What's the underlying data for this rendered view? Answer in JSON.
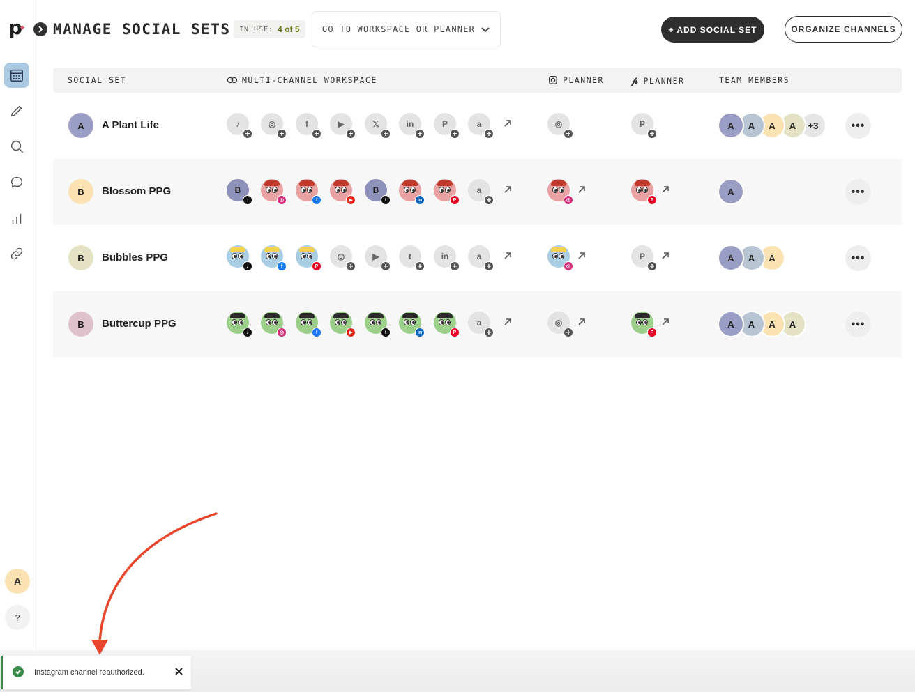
{
  "sidebar": {
    "logo_text": "p",
    "nav": [
      {
        "name": "calendar-icon",
        "active": true
      },
      {
        "name": "pencil-icon"
      },
      {
        "name": "search-icon"
      },
      {
        "name": "chat-icon"
      },
      {
        "name": "analytics-icon"
      },
      {
        "name": "link-icon"
      }
    ],
    "user_initial": "A",
    "help_label": "?"
  },
  "header": {
    "title": "MANAGE SOCIAL SETS",
    "in_use_label": "IN USE:",
    "in_use_value": "4 of 5",
    "goto_label": "GO TO WORKSPACE OR PLANNER",
    "add_button": "+ ADD SOCIAL SET",
    "organize_button": "ORGANIZE CHANNELS"
  },
  "table": {
    "columns": {
      "social_set": "SOCIAL SET",
      "workspace": "MULTI-CHANNEL WORKSPACE",
      "ig_planner": "PLANNER",
      "pin_planner": "PLANNER",
      "team": "TEAM MEMBERS"
    },
    "rows": [
      {
        "initial": "A",
        "name": "A Plant Life",
        "avatar_color": "#9a9dc4",
        "channels": [
          {
            "icon": "♪",
            "type": "empty"
          },
          {
            "icon": "◎",
            "type": "empty"
          },
          {
            "icon": "f",
            "type": "empty"
          },
          {
            "icon": "▶",
            "type": "empty"
          },
          {
            "icon": "𝕏",
            "type": "empty"
          },
          {
            "icon": "in",
            "type": "empty"
          },
          {
            "icon": "P",
            "type": "empty"
          },
          {
            "icon": "a",
            "type": "empty"
          }
        ],
        "ig_planner": {
          "icon": "◎",
          "type": "empty",
          "arrow": false
        },
        "pin_planner": {
          "icon": "P",
          "type": "empty",
          "arrow": false
        },
        "team": [
          "A",
          "A",
          "A",
          "A",
          "+3"
        ]
      },
      {
        "initial": "B",
        "name": "Blossom PPG",
        "avatar_color": "#fbe2b3",
        "channels": [
          {
            "icon": "B",
            "type": "letter",
            "badge": "tiktok"
          },
          {
            "icon": "",
            "type": "photo",
            "badge": "instagram"
          },
          {
            "icon": "",
            "type": "photo",
            "badge": "facebook"
          },
          {
            "icon": "",
            "type": "photo",
            "badge": "youtube"
          },
          {
            "icon": "B",
            "type": "letter",
            "badge": "twitter"
          },
          {
            "icon": "",
            "type": "photo",
            "badge": "linkedin"
          },
          {
            "icon": "",
            "type": "photo",
            "badge": "pinterest"
          },
          {
            "icon": "a",
            "type": "empty"
          }
        ],
        "ig_planner": {
          "icon": "",
          "type": "photo",
          "badge": "instagram",
          "arrow": true
        },
        "pin_planner": {
          "icon": "",
          "type": "photo",
          "badge": "pinterest",
          "arrow": true
        },
        "team": [
          "A"
        ]
      },
      {
        "initial": "B",
        "name": "Bubbles PPG",
        "avatar_color": "#e4e2c4",
        "channels": [
          {
            "icon": "",
            "type": "photo",
            "badge": "tiktok"
          },
          {
            "icon": "",
            "type": "photo",
            "badge": "facebook"
          },
          {
            "icon": "",
            "type": "photo",
            "badge": "pinterest"
          },
          {
            "icon": "◎",
            "type": "empty"
          },
          {
            "icon": "▶",
            "type": "empty"
          },
          {
            "icon": "t",
            "type": "empty"
          },
          {
            "icon": "in",
            "type": "empty"
          },
          {
            "icon": "a",
            "type": "empty"
          }
        ],
        "ig_planner": {
          "icon": "",
          "type": "photo",
          "badge": "instagram",
          "arrow": true
        },
        "pin_planner": {
          "icon": "P",
          "type": "empty",
          "arrow": true
        },
        "team": [
          "A",
          "A",
          "A"
        ]
      },
      {
        "initial": "B",
        "name": "Buttercup PPG",
        "avatar_color": "#e0c2cc",
        "channels": [
          {
            "icon": "",
            "type": "photo",
            "badge": "tiktok"
          },
          {
            "icon": "",
            "type": "photo",
            "badge": "instagram"
          },
          {
            "icon": "",
            "type": "photo",
            "badge": "facebook"
          },
          {
            "icon": "",
            "type": "photo",
            "badge": "youtube"
          },
          {
            "icon": "",
            "type": "photo",
            "badge": "twitter"
          },
          {
            "icon": "",
            "type": "photo",
            "badge": "linkedin"
          },
          {
            "icon": "",
            "type": "photo",
            "badge": "pinterest"
          },
          {
            "icon": "a",
            "type": "empty"
          }
        ],
        "ig_planner": {
          "icon": "◎",
          "type": "empty",
          "arrow": true
        },
        "pin_planner": {
          "icon": "",
          "type": "photo",
          "badge": "pinterest",
          "arrow": true
        },
        "team": [
          "A",
          "A",
          "A",
          "A"
        ]
      }
    ],
    "more_label": "•••"
  },
  "toast": {
    "message": "Instagram channel reauthorized."
  },
  "colors": {
    "accent_dark": "#2e2e2e",
    "success": "#3a8a4a",
    "annotation_arrow": "#e8472e",
    "team": [
      "#9a9dc4",
      "#b7c4d4",
      "#fbe2b3",
      "#e4e2c4"
    ],
    "badges": {
      "tiktok": "#111111",
      "instagram": "#d6307a",
      "facebook": "#1877f2",
      "youtube": "#e62117",
      "twitter": "#111111",
      "linkedin": "#0a66c2",
      "pinterest": "#e60023"
    }
  }
}
